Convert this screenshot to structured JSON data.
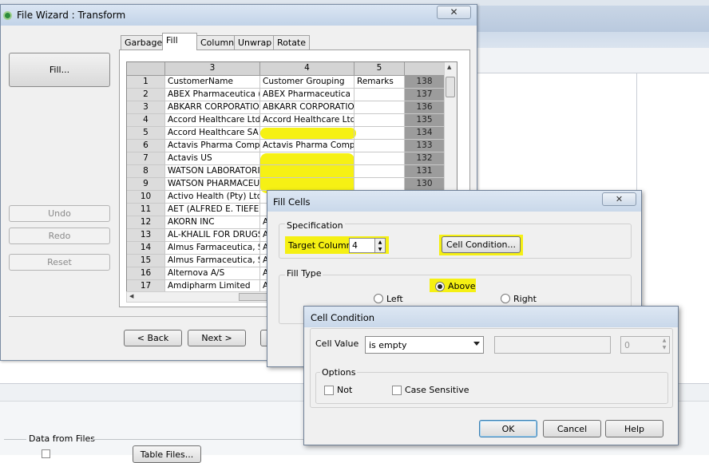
{
  "background": {
    "data_from_files_label": "Data from Files",
    "table_files_label": "Table Files..."
  },
  "wizard": {
    "title": "File Wizard : Transform",
    "close": "✕",
    "fill_button": "Fill...",
    "undo": "Undo",
    "redo": "Redo",
    "reset": "Reset",
    "back": "< Back",
    "next": "Next >",
    "tabs": [
      "Garbage",
      "Fill",
      "Column",
      "Unwrap",
      "Rotate"
    ],
    "grid": {
      "columns": [
        "3",
        "4",
        "5",
        ""
      ],
      "rows": [
        [
          "1",
          "CustomerName",
          "Customer Grouping",
          "Remarks",
          "138"
        ],
        [
          "2",
          "ABEX Pharmaceutica (Pty)",
          "ABEX Pharmaceutica (Pty)",
          "",
          "137"
        ],
        [
          "3",
          "ABKARR CORPORATION",
          "ABKARR CORPORATION",
          "",
          "136"
        ],
        [
          "4",
          "Accord Healthcare Ltd.",
          "Accord Healthcare Ltd.",
          "",
          "135"
        ],
        [
          "5",
          "Accord Healthcare SA",
          "",
          "",
          "134"
        ],
        [
          "6",
          "Actavis Pharma Company",
          "Actavis Pharma Company",
          "",
          "133"
        ],
        [
          "7",
          "Actavis US",
          "",
          "",
          "132"
        ],
        [
          "8",
          "WATSON LABORATORIES",
          "",
          "",
          "131"
        ],
        [
          "9",
          "WATSON PHARMACEUTICALS",
          "",
          "",
          "130"
        ],
        [
          "10",
          "Activo Health (Pty) Ltd",
          "",
          "",
          ""
        ],
        [
          "11",
          "AET (ALFRED E. TIEFENBACHER)",
          "",
          "",
          ""
        ],
        [
          "12",
          "AKORN INC",
          "A",
          "",
          ""
        ],
        [
          "13",
          "AL-KHALIL FOR DRUGS",
          "A",
          "",
          ""
        ],
        [
          "14",
          "Almus Farmaceutica, S.",
          "A",
          "",
          ""
        ],
        [
          "15",
          "Almus Farmaceutica, S.",
          "A",
          "",
          ""
        ],
        [
          "16",
          "Alternova A/S",
          "A",
          "",
          ""
        ],
        [
          "17",
          "Amdipharm Limited",
          "A",
          "",
          ""
        ]
      ]
    }
  },
  "fill_cells": {
    "title": "Fill Cells",
    "close": "✕",
    "specification_label": "Specification",
    "target_column_label": "Target Column",
    "target_column_value": "4",
    "cell_condition_button": "Cell Condition...",
    "fill_type_label": "Fill Type",
    "above": "Above",
    "left": "Left",
    "right": "Right",
    "selected": "Above"
  },
  "cell_condition": {
    "title": "Cell Condition",
    "cell_value_label": "Cell Value",
    "cell_value_selected": "is empty",
    "number_value": "0",
    "options_label": "Options",
    "not_label": "Not",
    "case_sensitive_label": "Case Sensitive",
    "ok": "OK",
    "cancel": "Cancel",
    "help": "Help"
  },
  "colors": {
    "highlight": "#f5f000",
    "title_bar": "#c9d8ea"
  }
}
